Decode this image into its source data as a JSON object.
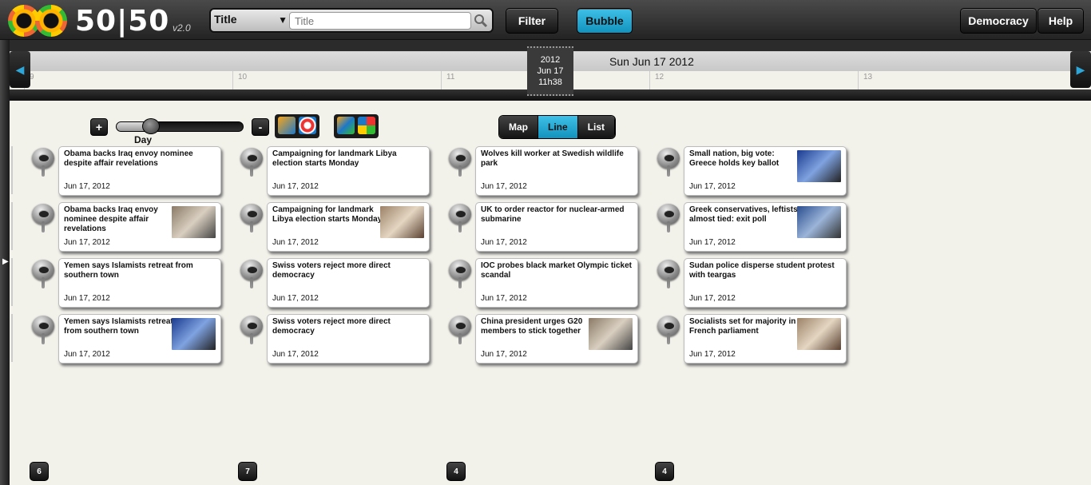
{
  "app": {
    "logo_text": "50|50",
    "version": "v2.0"
  },
  "search": {
    "field_label": "Title",
    "placeholder": "Title"
  },
  "toolbar": {
    "filter_label": "Filter",
    "bubble_label": "Bubble",
    "democracy_label": "Democracy",
    "help_label": "Help"
  },
  "timeline": {
    "date_header": "Sun Jun 17 2012",
    "cursor": {
      "year": "2012",
      "day": "Jun 17",
      "time": "11h38"
    },
    "ticks": [
      "9",
      "10",
      "11",
      "12",
      "13"
    ]
  },
  "controls": {
    "zoom_in": "+",
    "zoom_out": "-",
    "zoom_level": "Day",
    "zoom_position": 0.2,
    "views": [
      "Map",
      "Line",
      "List"
    ],
    "active_view": "Line"
  },
  "columns": [
    {
      "count": "6",
      "cards": [
        {
          "title": "Obama backs Iraq envoy nominee despite affair revelations",
          "date": "Jun 17, 2012",
          "thumb": false
        },
        {
          "title": "Obama backs Iraq envoy nominee despite affair revelations",
          "date": "Jun 17, 2012",
          "thumb": true
        },
        {
          "title": "Yemen says Islamists retreat from southern town",
          "date": "Jun 17, 2012",
          "thumb": false
        },
        {
          "title": "Yemen says Islamists retreat from southern town",
          "date": "Jun 17, 2012",
          "thumb": true
        }
      ]
    },
    {
      "count": "7",
      "cards": [
        {
          "title": "Campaigning for landmark Libya election starts Monday",
          "date": "Jun 17, 2012",
          "thumb": false
        },
        {
          "title": "Campaigning for landmark Libya election starts Monday",
          "date": "Jun 17, 2012",
          "thumb": true
        },
        {
          "title": "Swiss voters reject more direct democracy",
          "date": "Jun 17, 2012",
          "thumb": false
        },
        {
          "title": "Swiss voters reject more direct democracy",
          "date": "Jun 17, 2012",
          "thumb": false
        }
      ]
    },
    {
      "count": "4",
      "cards": [
        {
          "title": "Wolves kill worker at Swedish wildlife park",
          "date": "Jun 17, 2012",
          "thumb": false
        },
        {
          "title": "UK to order reactor for nuclear-armed submarine",
          "date": "Jun 17, 2012",
          "thumb": false
        },
        {
          "title": "IOC probes black market Olympic ticket scandal",
          "date": "Jun 17, 2012",
          "thumb": false
        },
        {
          "title": "China president urges G20 members to stick together",
          "date": "Jun 17, 2012",
          "thumb": true
        }
      ]
    },
    {
      "count": "4",
      "cards": [
        {
          "title": "Small nation, big vote: Greece holds key ballot",
          "date": "Jun 17, 2012",
          "thumb": true
        },
        {
          "title": "Greek conservatives, leftists almost tied: exit poll",
          "date": "Jun 17, 2012",
          "thumb": true
        },
        {
          "title": "Sudan police disperse student protest with teargas",
          "date": "Jun 17, 2012",
          "thumb": false
        },
        {
          "title": "Socialists set for majority in French parliament",
          "date": "Jun 17, 2012",
          "thumb": true
        }
      ]
    }
  ],
  "colors": {
    "accent": "#1fa3cf",
    "toolbar": "#2a2a2a",
    "background": "#f2f1ea"
  }
}
